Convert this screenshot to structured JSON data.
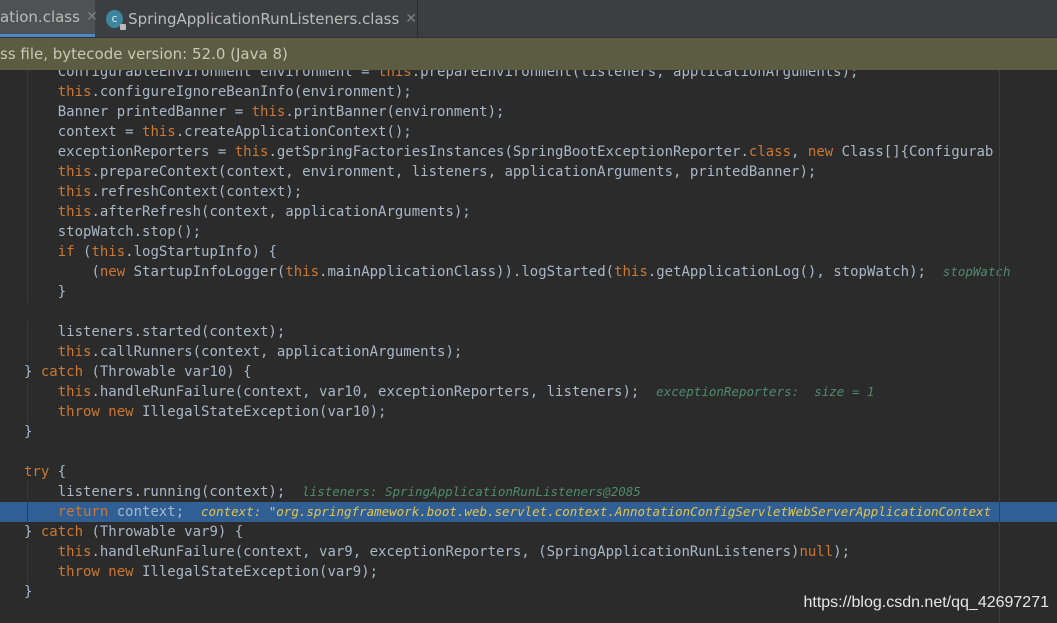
{
  "tabs": [
    {
      "label": "ation.class",
      "active": true
    },
    {
      "label": "SpringApplicationRunListeners.class",
      "icon": "class-file-icon"
    }
  ],
  "banner": "ss file, bytecode version: 52.0 (Java 8)",
  "watermark": "https://blog.csdn.net/qq_42697271",
  "colors": {
    "background": "#2b2b2b",
    "keyword": "#cc7832",
    "text": "#a9b7c6",
    "hint": "#4f8b6c",
    "highlight": "#2f5f95",
    "banner": "#5c5c43"
  },
  "code": [
    {
      "i": 1,
      "t": [
        [
          "p",
          "ConfigurableEnvironment environment = "
        ],
        [
          "kw",
          "this"
        ],
        [
          "p",
          ".prepareEnvironment(listeners, applicationArguments);"
        ]
      ]
    },
    {
      "i": 1,
      "t": [
        [
          "kw",
          "this"
        ],
        [
          "p",
          ".configureIgnoreBeanInfo(environment);"
        ]
      ]
    },
    {
      "i": 1,
      "t": [
        [
          "p",
          "Banner printedBanner = "
        ],
        [
          "kw",
          "this"
        ],
        [
          "p",
          ".printBanner(environment);"
        ]
      ]
    },
    {
      "i": 1,
      "t": [
        [
          "p",
          "context = "
        ],
        [
          "kw",
          "this"
        ],
        [
          "p",
          ".createApplicationContext();"
        ]
      ]
    },
    {
      "i": 1,
      "t": [
        [
          "p",
          "exceptionReporters = "
        ],
        [
          "kw",
          "this"
        ],
        [
          "p",
          ".getSpringFactoriesInstances(SpringBootExceptionReporter."
        ],
        [
          "kw",
          "class"
        ],
        [
          "p",
          ", "
        ],
        [
          "kw",
          "new"
        ],
        [
          "p",
          " Class[]{Configurab"
        ]
      ]
    },
    {
      "i": 1,
      "t": [
        [
          "kw",
          "this"
        ],
        [
          "p",
          ".prepareContext(context, environment, listeners, applicationArguments, printedBanner);"
        ]
      ]
    },
    {
      "i": 1,
      "t": [
        [
          "kw",
          "this"
        ],
        [
          "p",
          ".refreshContext(context);"
        ]
      ]
    },
    {
      "i": 1,
      "t": [
        [
          "kw",
          "this"
        ],
        [
          "p",
          ".afterRefresh(context, applicationArguments);"
        ]
      ]
    },
    {
      "i": 1,
      "t": [
        [
          "p",
          "stopWatch.stop();"
        ]
      ]
    },
    {
      "i": 1,
      "t": [
        [
          "kw",
          "if"
        ],
        [
          "p",
          " ("
        ],
        [
          "kw",
          "this"
        ],
        [
          "p",
          ".logStartupInfo) {"
        ]
      ]
    },
    {
      "i": 2,
      "t": [
        [
          "p",
          "("
        ],
        [
          "kw",
          "new"
        ],
        [
          "p",
          " StartupInfoLogger("
        ],
        [
          "kw",
          "this"
        ],
        [
          "p",
          ".mainApplicationClass)).logStarted("
        ],
        [
          "kw",
          "this"
        ],
        [
          "p",
          ".getApplicationLog(), stopWatch);  "
        ],
        [
          "hint",
          "stopWatch"
        ]
      ]
    },
    {
      "i": 1,
      "t": [
        [
          "p",
          "}"
        ]
      ]
    },
    {
      "i": 0,
      "t": []
    },
    {
      "i": 1,
      "t": [
        [
          "p",
          "listeners.started(context);"
        ]
      ]
    },
    {
      "i": 1,
      "t": [
        [
          "kw",
          "this"
        ],
        [
          "p",
          ".callRunners(context, applicationArguments);"
        ]
      ]
    },
    {
      "i": 0,
      "t": [
        [
          "p",
          "} "
        ],
        [
          "kw",
          "catch"
        ],
        [
          "p",
          " (Throwable var10) {"
        ]
      ]
    },
    {
      "i": 1,
      "t": [
        [
          "kw",
          "this"
        ],
        [
          "p",
          ".handleRunFailure(context, var10, exceptionReporters, listeners);  "
        ],
        [
          "hint",
          "exceptionReporters:  size = 1"
        ]
      ]
    },
    {
      "i": 1,
      "t": [
        [
          "kw",
          "throw new"
        ],
        [
          "p",
          " IllegalStateException(var10);"
        ]
      ]
    },
    {
      "i": 0,
      "t": [
        [
          "p",
          "}"
        ]
      ]
    },
    {
      "i": 0,
      "t": []
    },
    {
      "i": 0,
      "t": [
        [
          "kw",
          "try"
        ],
        [
          "p",
          " {"
        ]
      ]
    },
    {
      "i": 1,
      "t": [
        [
          "p",
          "listeners.running(context);  "
        ],
        [
          "hint",
          "listeners: SpringApplicationRunListeners@2085"
        ]
      ]
    },
    {
      "i": 1,
      "hl": true,
      "t": [
        [
          "kw",
          "return"
        ],
        [
          "p",
          " context;  "
        ],
        [
          "hint",
          "context: \"org.springframework.boot.web.servlet.context.AnnotationConfigServletWebServerApplicationContext"
        ]
      ]
    },
    {
      "i": 0,
      "t": [
        [
          "p",
          "} "
        ],
        [
          "kw",
          "catch"
        ],
        [
          "p",
          " (Throwable var9) {"
        ]
      ]
    },
    {
      "i": 1,
      "t": [
        [
          "kw",
          "this"
        ],
        [
          "p",
          ".handleRunFailure(context, var9, exceptionReporters, (SpringApplicationRunListeners)"
        ],
        [
          "kw",
          "null"
        ],
        [
          "p",
          ");"
        ]
      ]
    },
    {
      "i": 1,
      "t": [
        [
          "kw",
          "throw new"
        ],
        [
          "p",
          " IllegalStateException(var9);"
        ]
      ]
    },
    {
      "i": 0,
      "t": [
        [
          "p",
          "}"
        ]
      ]
    }
  ]
}
